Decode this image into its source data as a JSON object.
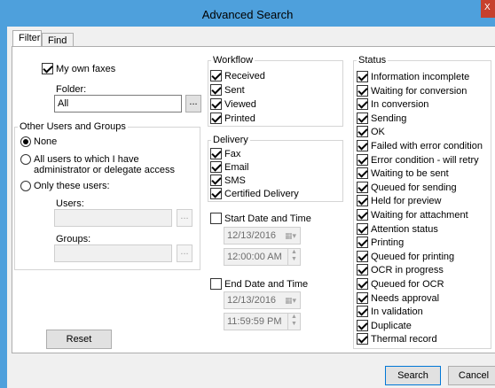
{
  "window": {
    "title": "Advanced Search",
    "close_glyph": "X"
  },
  "tabs": [
    {
      "label": "Filter"
    },
    {
      "label": "Find"
    }
  ],
  "filter": {
    "my_own_faxes": {
      "label": "My own faxes",
      "checked": true
    },
    "folder": {
      "label": "Folder:",
      "value": "All",
      "browse": "..."
    },
    "other_users": {
      "title": "Other Users and Groups",
      "options": [
        {
          "label": "None",
          "selected": true
        },
        {
          "label": "All users to which I have",
          "label2": "administrator or delegate access",
          "selected": false
        },
        {
          "label": "Only these users:",
          "selected": false
        }
      ],
      "users_label": "Users:",
      "users_value": "",
      "users_browse": "...",
      "groups_label": "Groups:",
      "groups_value": "",
      "groups_browse": "..."
    },
    "reset": "Reset"
  },
  "workflow": {
    "title": "Workflow",
    "items": [
      {
        "label": "Received",
        "checked": true
      },
      {
        "label": "Sent",
        "checked": true
      },
      {
        "label": "Viewed",
        "checked": true
      },
      {
        "label": "Printed",
        "checked": true
      }
    ]
  },
  "delivery": {
    "title": "Delivery",
    "items": [
      {
        "label": "Fax",
        "checked": true
      },
      {
        "label": "Email",
        "checked": true
      },
      {
        "label": "SMS",
        "checked": true
      },
      {
        "label": "Certified Delivery",
        "checked": true
      }
    ]
  },
  "start": {
    "label": "Start Date and Time",
    "checked": false,
    "date": "12/13/2016",
    "time": "12:00:00 AM"
  },
  "end": {
    "label": "End Date and Time",
    "checked": false,
    "date": "12/13/2016",
    "time": "11:59:59 PM"
  },
  "status": {
    "title": "Status",
    "items": [
      {
        "label": "Information incomplete",
        "checked": true
      },
      {
        "label": "Waiting for conversion",
        "checked": true
      },
      {
        "label": "In conversion",
        "checked": true
      },
      {
        "label": "Sending",
        "checked": true
      },
      {
        "label": "OK",
        "checked": true
      },
      {
        "label": "Failed with error condition",
        "checked": true
      },
      {
        "label": "Error condition - will retry",
        "checked": true
      },
      {
        "label": "Waiting to be sent",
        "checked": true
      },
      {
        "label": "Queued for sending",
        "checked": true
      },
      {
        "label": "Held for preview",
        "checked": true
      },
      {
        "label": "Waiting for attachment",
        "checked": true
      },
      {
        "label": "Attention status",
        "checked": true
      },
      {
        "label": "Printing",
        "checked": true
      },
      {
        "label": "Queued for printing",
        "checked": true
      },
      {
        "label": "OCR in progress",
        "checked": true
      },
      {
        "label": "Queued for OCR",
        "checked": true
      },
      {
        "label": "Needs approval",
        "checked": true
      },
      {
        "label": "In validation",
        "checked": true
      },
      {
        "label": "Duplicate",
        "checked": true
      },
      {
        "label": "Thermal record",
        "checked": true
      }
    ]
  },
  "footer": {
    "search": "Search",
    "cancel": "Cancel"
  },
  "colors": {
    "titlebar": "#4ea0dc",
    "close": "#c7402d",
    "dialog": "#f0f0f0"
  }
}
